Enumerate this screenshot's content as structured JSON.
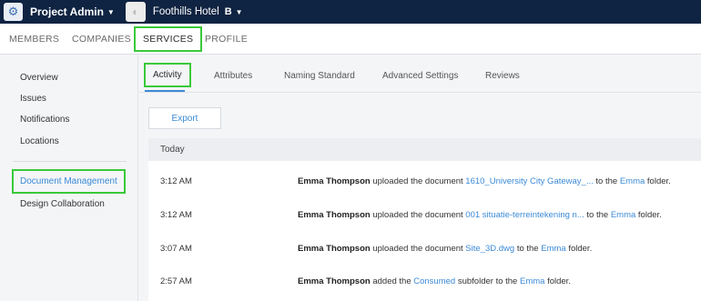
{
  "topbar": {
    "app_title": "Project Admin",
    "app_icon": "gear-icon",
    "project_name": "Foothills Hotel",
    "project_badge": "B"
  },
  "main_tabs": [
    {
      "label": "MEMBERS"
    },
    {
      "label": "COMPANIES"
    },
    {
      "label": "SERVICES"
    },
    {
      "label": "PROFILE"
    }
  ],
  "sidebar": {
    "items": [
      {
        "label": "Overview"
      },
      {
        "label": "Issues"
      },
      {
        "label": "Notifications"
      },
      {
        "label": "Locations"
      },
      {
        "label": "Document Management"
      },
      {
        "label": "Design Collaboration"
      }
    ]
  },
  "subtabs": [
    {
      "label": "Activity"
    },
    {
      "label": "Attributes"
    },
    {
      "label": "Naming Standard"
    },
    {
      "label": "Advanced Settings"
    },
    {
      "label": "Reviews"
    }
  ],
  "export_label": "Export",
  "activity": {
    "group_label": "Today",
    "rows": [
      {
        "time": "3:12 AM",
        "user": "Emma Thompson",
        "action": "uploaded the document",
        "target": "1610_University City Gateway_...",
        "middle": "to the",
        "folder": "Emma",
        "end": "folder."
      },
      {
        "time": "3:12 AM",
        "user": "Emma Thompson",
        "action": "uploaded the document",
        "target": "001 situatie-terreintekening n...",
        "middle": "to the",
        "folder": "Emma",
        "end": "folder."
      },
      {
        "time": "3:07 AM",
        "user": "Emma Thompson",
        "action": "uploaded the document",
        "target": "Site_3D.dwg",
        "middle": "to the",
        "folder": "Emma",
        "end": "folder."
      },
      {
        "time": "2:57 AM",
        "user": "Emma Thompson",
        "action": "added the",
        "target": "Consumed",
        "middle": "subfolder to the",
        "folder": "Emma",
        "end": "folder."
      }
    ]
  }
}
